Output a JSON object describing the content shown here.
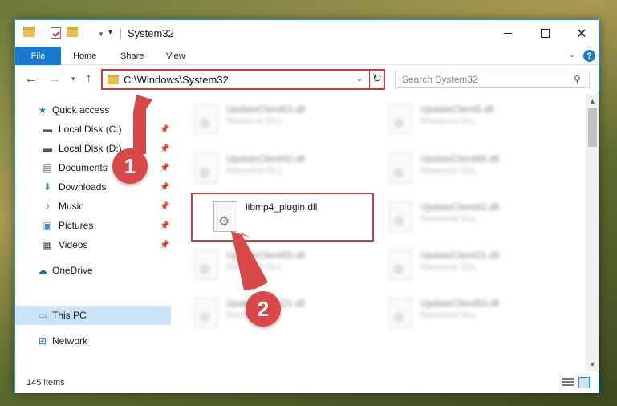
{
  "window": {
    "title": "System32"
  },
  "ribbon": {
    "file": "File",
    "home": "Home",
    "share": "Share",
    "view": "View",
    "help": "?"
  },
  "address": {
    "path": "C:\\Windows\\System32"
  },
  "search": {
    "placeholder": "Search System32"
  },
  "sidebar": {
    "items": [
      {
        "label": "Quick access",
        "icon": "star-icon"
      },
      {
        "label": "Local Disk (C:)",
        "icon": "drive-icon",
        "pinned": true
      },
      {
        "label": "Local Disk (D:)",
        "icon": "drive-icon",
        "pinned": true
      },
      {
        "label": "Documents",
        "icon": "documents-icon",
        "pinned": true
      },
      {
        "label": "Downloads",
        "icon": "downloads-icon",
        "pinned": true
      },
      {
        "label": "Music",
        "icon": "music-icon",
        "pinned": true
      },
      {
        "label": "Pictures",
        "icon": "pictures-icon",
        "pinned": true
      },
      {
        "label": "Videos",
        "icon": "videos-icon",
        "pinned": true
      },
      {
        "label": "OneDrive",
        "icon": "cloud-icon"
      },
      {
        "label": "This PC",
        "icon": "pc-icon",
        "selected": true
      },
      {
        "label": "Network",
        "icon": "network-icon"
      }
    ]
  },
  "files": [
    {
      "name": "UpdateClient63.dll",
      "type": "Resource DLL"
    },
    {
      "name": "UpdateClient5.dll",
      "type": "Resource DLL"
    },
    {
      "name": "UpdateClient42.dll",
      "type": "Resource DLL"
    },
    {
      "name": "UpdateClient65.dll",
      "type": "Resource DLL"
    },
    {
      "name": "libmp4_plugin.dll",
      "type": ""
    },
    {
      "name": "UpdateClient42.dll",
      "type": "Resource DLL"
    },
    {
      "name": "UpdateClient65.dll",
      "type": "Resource DLL"
    },
    {
      "name": "UpdateClient21.dll",
      "type": "Resource DLL"
    },
    {
      "name": "UpdateClient21.dll",
      "type": "Resource DLL"
    },
    {
      "name": "UpdateClient63.dll",
      "type": "Resource DLL"
    }
  ],
  "status": {
    "count": "145 items"
  },
  "annotations": {
    "badge1": "1",
    "badge2": "2"
  },
  "colors": {
    "accent": "#1979ca",
    "highlight": "#d23b3b",
    "selected": "#cce4f7"
  }
}
